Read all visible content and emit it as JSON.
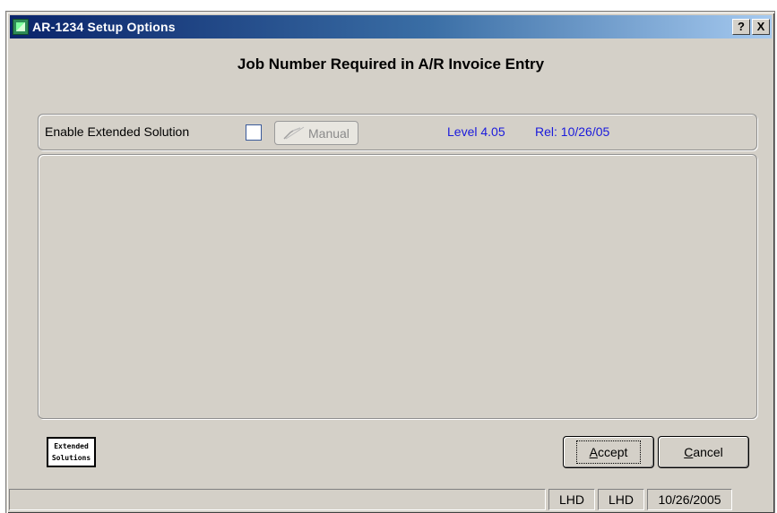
{
  "window": {
    "title": "AR-1234 Setup Options",
    "help_label": "?",
    "close_label": "X"
  },
  "heading": "Job Number Required in A/R Invoice Entry",
  "options": {
    "enable_label": "Enable Extended Solution",
    "enabled": false,
    "manual_label": "Manual",
    "level": "Level 4.05",
    "release": "Rel: 10/26/05"
  },
  "logo": {
    "line1": "Extended",
    "line2": "Solutions"
  },
  "buttons": {
    "accept_hotkey": "A",
    "accept_rest": "ccept",
    "cancel_hotkey": "C",
    "cancel_rest": "ancel"
  },
  "status": {
    "message": "",
    "user1": "LHD",
    "user2": "LHD",
    "date": "10/26/2005"
  },
  "colors": {
    "window_bg": "#d4d0c8",
    "title_start": "#0a246a",
    "title_end": "#a6caf0",
    "version_text": "#1a1adc"
  }
}
